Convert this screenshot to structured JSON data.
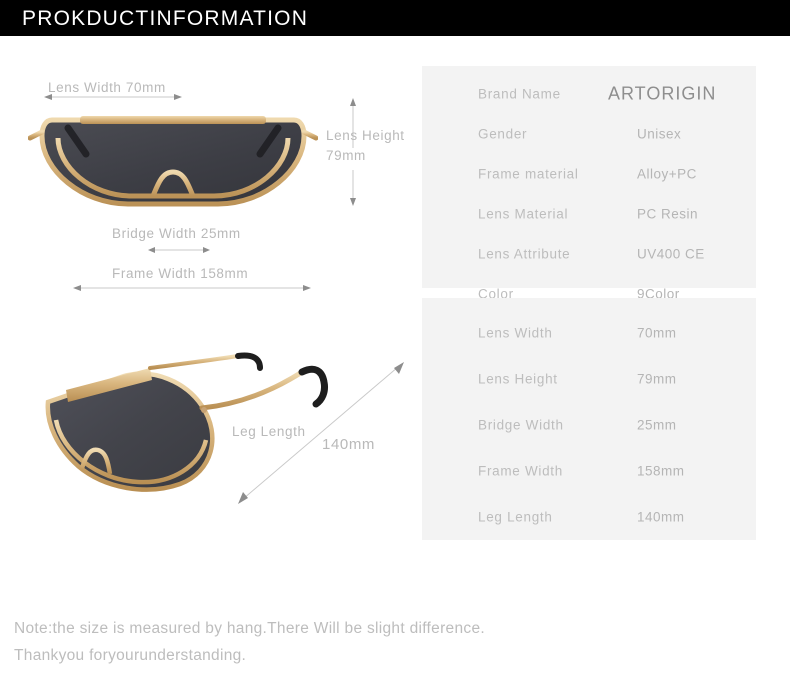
{
  "header": {
    "title": "PROKDUCTINFORMATION"
  },
  "product_views": {
    "front_view": {
      "name": "sunglasses-front-view",
      "lens_color": "#3f4046",
      "frame_color": "#d8b47c",
      "temple_tip_color": "#232323"
    },
    "angled_view": {
      "name": "sunglasses-angled-view",
      "lens_color": "#45464c",
      "frame_color": "#d8b47c",
      "temple_tip_color": "#1e1e1e"
    }
  },
  "dimension_callouts": [
    {
      "id": "lens-width",
      "label": "Lens  Width  70mm"
    },
    {
      "id": "lens-height",
      "label_line1": "Lens Height",
      "label_line2": "79mm"
    },
    {
      "id": "bridge-width",
      "label": "Bridge  Width  25mm"
    },
    {
      "id": "frame-width",
      "label": "Frame   Width    158mm"
    },
    {
      "id": "leg-length",
      "label_line1": "Leg Length",
      "label_line2": "140mm"
    }
  ],
  "spec_panels": {
    "primary": [
      {
        "label": "Brand  Name",
        "value": "ARTORIGIN"
      },
      {
        "label": "Gender",
        "value": "Unisex"
      },
      {
        "label": "Frame  material",
        "value": "Alloy+PC"
      },
      {
        "label": "Lens  Material",
        "value": "PC Resin"
      },
      {
        "label": "Lens  Attribute",
        "value": "UV400 CE"
      },
      {
        "label": "Color",
        "value": "9Color"
      }
    ],
    "measurements": [
      {
        "label": "Lens  Width",
        "value": "70mm"
      },
      {
        "label": "Lens  Height",
        "value": "79mm"
      },
      {
        "label": "Bridge   Width",
        "value": "25mm"
      },
      {
        "label": "Frame   Width",
        "value": "158mm"
      },
      {
        "label": "Leg  Length",
        "value": "140mm"
      }
    ]
  },
  "footer": {
    "line1": "Note:the size is measured by hang.There Will be slight difference.",
    "line2": "Thankyou foryourunderstanding."
  },
  "colors": {
    "header_background": "#000000",
    "header_text": "#ffffff",
    "panel_background": "#f3f3f3",
    "label_text": "#bdbdbd",
    "value_text": "#b5b5b5",
    "brand_text": "#8e8e8e",
    "arrow_line": "#c9c9c9"
  }
}
